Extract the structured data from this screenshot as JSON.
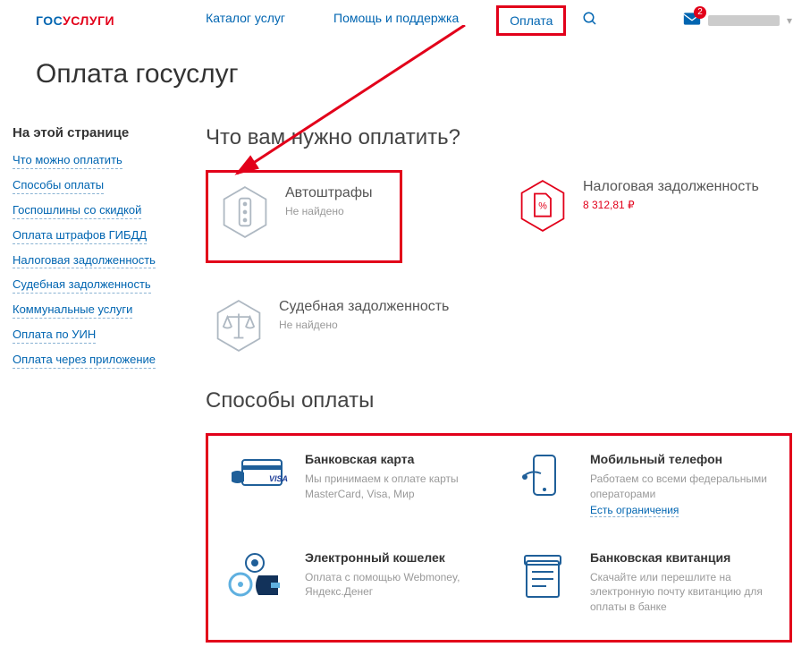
{
  "brand": {
    "part1": "ГОС",
    "part2": "УСЛУГИ"
  },
  "nav": {
    "catalog": "Каталог услуг",
    "support": "Помощь и поддержка",
    "payment": "Оплата"
  },
  "mail_badge": "2",
  "page_title": "Оплата госуслуг",
  "sidebar": {
    "title": "На этой странице",
    "links": {
      "what": "Что можно оплатить",
      "methods": "Способы оплаты",
      "duty": "Госпошлины со скидкой",
      "gibdd": "Оплата штрафов ГИБДД",
      "tax": "Налоговая задолженность",
      "court": "Судебная задолженность",
      "utilities": "Коммунальные услуги",
      "uin": "Оплата по УИН",
      "app": "Оплата через приложение"
    }
  },
  "what_to_pay": {
    "heading": "Что вам нужно оплатить?",
    "fines": {
      "title": "Автоштрафы",
      "status": "Не найдено"
    },
    "tax": {
      "title": "Налоговая задолженность",
      "status": "8 312,81 ₽"
    },
    "court": {
      "title": "Судебная задолженность",
      "status": "Не найдено"
    }
  },
  "methods": {
    "heading": "Способы оплаты",
    "card": {
      "title": "Банковская карта",
      "sub": "Мы принимаем к оплате карты MasterCard, Visa, Мир"
    },
    "mobile": {
      "title": "Мобильный телефон",
      "sub": "Работаем со всеми федеральными операторами",
      "link": "Есть ограничения"
    },
    "wallet": {
      "title": "Электронный кошелек",
      "sub": "Оплата с помощью Webmoney, Яндекс.Денег"
    },
    "receipt": {
      "title": "Банковская квитанция",
      "sub": "Скачайте или перешлите на электронную почту квитанцию для оплаты в банке"
    }
  }
}
